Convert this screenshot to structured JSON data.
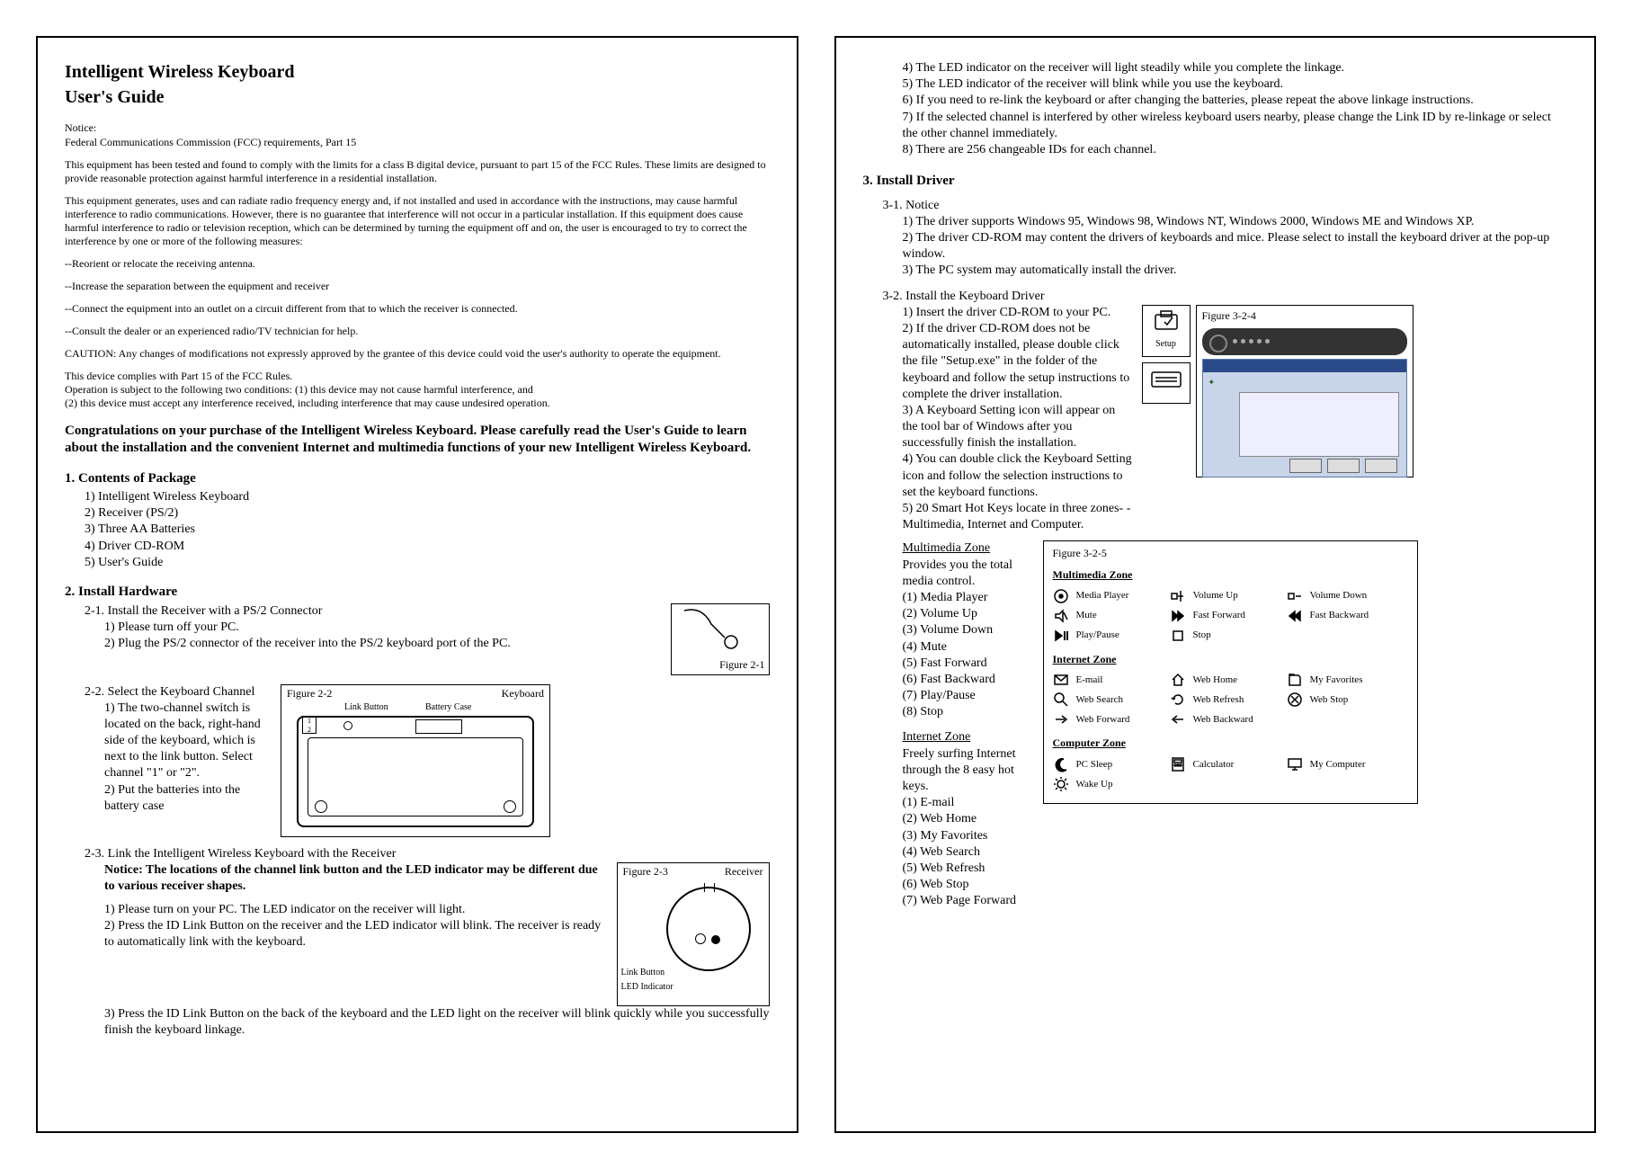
{
  "title1": "Intelligent Wireless Keyboard",
  "title2": "User's Guide",
  "notice_label": "Notice:",
  "fine_print_1": "Federal Communications Commission (FCC) requirements, Part 15",
  "fine_print_2": "This equipment has been tested and found to comply with the limits for a class B digital device, pursuant to part 15 of the FCC Rules. These limits are designed to provide reasonable protection against harmful interference in a residential installation.",
  "fine_print_3": "This equipment generates, uses and can radiate radio frequency energy and, if not installed and used in accordance with the instructions, may cause harmful interference to radio communications. However, there is no guarantee that interference will not occur in a particular installation.  If this equipment does cause harmful interference to radio or television reception, which can be determined by turning the equipment off and on, the user is encouraged to try to correct the interference by one or more of the following measures:",
  "fine_bullets": [
    "--Reorient or relocate the receiving antenna.",
    "--Increase the separation between the equipment and receiver",
    "--Connect the equipment into an outlet on a circuit different from that to which the receiver is connected.",
    "--Consult the dealer or an experienced radio/TV technician for help."
  ],
  "caution": "CAUTION: Any changes of modifications not expressly approved by the grantee of this device could void the user's authority to operate the equipment.",
  "complies1": "This device complies with Part 15 of the FCC Rules.",
  "complies2": "Operation is subject to the following two conditions: (1) this device may not cause harmful interference, and",
  "complies3": " (2) this device must accept any interference received, including interference that may cause undesired operation.",
  "congrats": "Congratulations on your purchase of the Intelligent Wireless Keyboard.  Please carefully read the User's Guide to learn about the installation and the convenient Internet and multimedia functions of your new Intelligent Wireless Keyboard.",
  "s1_head": "1. Contents of Package",
  "s1_items": [
    "1) Intelligent Wireless Keyboard",
    "2) Receiver (PS/2)",
    "3) Three AA Batteries",
    "4) Driver  CD-ROM",
    "5) User's Guide"
  ],
  "s2_head": "2. Install Hardware",
  "s2_1_head": "2-1. Install the Receiver with a PS/2 Connector",
  "s2_1_items": [
    "1) Please turn off your PC.",
    "2) Plug the PS/2 connector of the receiver into the PS/2 keyboard port of the PC."
  ],
  "fig21": "Figure 2-1",
  "s2_2_head": "2-2. Select the Keyboard Channel",
  "s2_2_items": [
    "1) The two-channel switch is located on the back, right-hand side of the keyboard, which is next to the link button.  Select channel \"1\" or \"2\".",
    "2) Put the batteries into the battery case"
  ],
  "fig22": "Figure 2-2",
  "fig22_linkbtn": "Link Button",
  "fig22_battery": "Battery Case",
  "fig22_keyboard": "Keyboard",
  "s2_3_head": "2-3. Link the Intelligent Wireless Keyboard with the Receiver",
  "s2_3_notice": "Notice: The locations of the channel link button and the LED indicator may be different due to various receiver shapes.",
  "s2_3_items": [
    "1) Please turn on your PC.  The LED indicator on the receiver will light.",
    "2) Press the ID Link Button on the receiver and the LED indicator will blink.  The receiver is ready to automatically link with the keyboard.",
    "3) Press the ID Link Button on the back of the keyboard and the LED light on the receiver will blink quickly while you successfully finish the keyboard linkage."
  ],
  "fig23": "Figure 2-3",
  "fig23_receiver": "Receiver",
  "fig23_linkbtn": "Link Button",
  "fig23_led": "LED Indicator",
  "right_top_items": [
    "4) The LED indicator on the receiver will light steadily while you complete the linkage.",
    "5) The LED indicator of the receiver will blink while you use the keyboard.",
    "6) If you need to re-link the keyboard or after changing the batteries, please repeat the above linkage instructions.",
    "7) If the selected channel is interfered by other wireless keyboard users nearby, please change the Link ID by re-linkage or select the other channel immediately.",
    "8) There are 256 changeable IDs for each channel."
  ],
  "s3_head": "3. Install Driver",
  "s3_1_head": "3-1. Notice",
  "s3_1_items": [
    "1) The driver supports Windows 95, Windows 98, Windows NT, Windows 2000, Windows ME and Windows XP.",
    "2) The driver CD-ROM may content the drivers of keyboards and mice.  Please select to install the keyboard driver at the pop-up window.",
    "3) The PC system may automatically install the driver."
  ],
  "s3_2_head": "3-2. Install the Keyboard Driver",
  "s3_2_items": [
    "1) Insert the driver CD-ROM to your PC.",
    "2) If the driver CD-ROM does not be automatically installed, please double click the file \"Setup.exe\" in the folder of the keyboard and follow the setup instructions to complete the driver installation.",
    "3) A Keyboard Setting icon will appear on the tool bar of Windows after you successfully finish the installation.",
    "4) You can double click the Keyboard Setting icon and follow the selection instructions to set the keyboard functions.",
    "5) 20 Smart Hot Keys locate in three zones- -Multimedia, Internet and Computer."
  ],
  "fig324": "Figure 3-2-4",
  "icon_setup": "Setup",
  "mm_zone_head": "Multimedia Zone",
  "mm_zone_sub": "Provides you the total  media control.",
  "mm_list": [
    "(1)  Media Player",
    "(2)  Volume Up",
    "(3)  Volume Down",
    "(4)  Mute",
    "(5)  Fast Forward",
    "(6)  Fast Backward",
    "(7)  Play/Pause",
    "(8)  Stop"
  ],
  "iz_head": "Internet Zone",
  "iz_sub": "Freely surfing Internet through the 8 easy hot keys.",
  "iz_list": [
    "(1)  E-mail",
    "(2)  Web Home",
    "(3)  My Favorites",
    "(4)  Web Search",
    "(5)  Web Refresh",
    "(6)  Web Stop",
    "(7)  Web Page Forward"
  ],
  "fig325": "Figure 3-2-5",
  "hot_mm_title": "Multimedia Zone",
  "hot_iz_title": "Internet Zone",
  "hot_cz_title": "Computer Zone",
  "hot_mm": [
    {
      "label": "Media Player"
    },
    {
      "label": "Volume Up"
    },
    {
      "label": "Volume Down"
    },
    {
      "label": "Mute"
    },
    {
      "label": "Fast Forward"
    },
    {
      "label": "Fast Backward"
    },
    {
      "label": "Play/Pause"
    },
    {
      "label": "Stop"
    }
  ],
  "hot_iz": [
    {
      "label": "E-mail"
    },
    {
      "label": "Web Home"
    },
    {
      "label": "My Favorites"
    },
    {
      "label": "Web Search"
    },
    {
      "label": "Web Refresh"
    },
    {
      "label": "Web Stop"
    },
    {
      "label": "Web Forward"
    },
    {
      "label": "Web Backward"
    }
  ],
  "hot_cz": [
    {
      "label": "PC Sleep"
    },
    {
      "label": "Calculator"
    },
    {
      "label": "My Computer"
    },
    {
      "label": "Wake Up"
    }
  ]
}
